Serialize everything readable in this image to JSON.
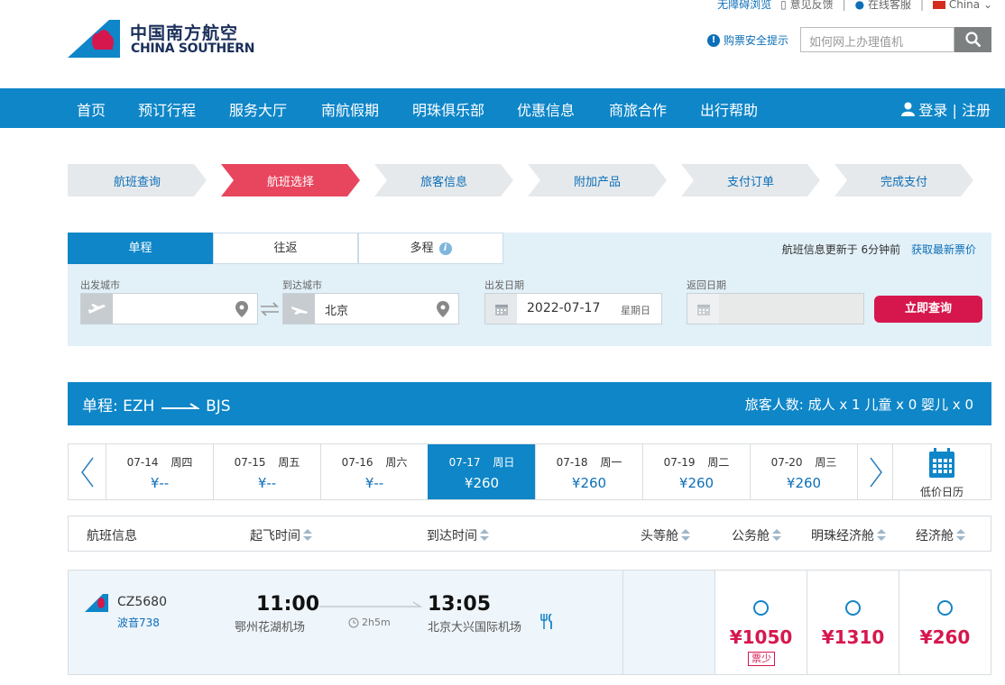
{
  "toplinks": {
    "accessible": "无障碍浏览",
    "feedback": "意见反馈",
    "service": "在线客服",
    "region": "China"
  },
  "brand": {
    "cn": "中国南方航空",
    "en": "CHINA SOUTHERN"
  },
  "header": {
    "safety_tip": "购票安全提示",
    "search_placeholder": "如何网上办理值机"
  },
  "nav": {
    "items": [
      "首页",
      "预订行程",
      "服务大厅",
      "南航假期",
      "明珠俱乐部",
      "优惠信息",
      "商旅合作",
      "出行帮助"
    ],
    "login": "登录 | 注册"
  },
  "steps": [
    "航班查询",
    "航班选择",
    "旅客信息",
    "附加产品",
    "支付订单",
    "完成支付"
  ],
  "search": {
    "tabs": [
      "单程",
      "往返",
      "多程"
    ],
    "update_text": "航班信息更新于 6分钟前",
    "refresh_link": "获取最新票价",
    "from_label": "出发城市",
    "from_value": "",
    "to_label": "到达城市",
    "to_value": "北京",
    "depart_label": "出发日期",
    "depart_value": "2022-07-17",
    "depart_dow": "星期日",
    "return_label": "返回日期",
    "query_button": "立即查询"
  },
  "route": {
    "summary_prefix": "单程: EZH",
    "summary_suffix": "BJS",
    "passengers": "旅客人数: 成人 x 1 儿童 x 0 婴儿 x 0"
  },
  "dates": [
    {
      "date": "07-14 周四",
      "price": "¥--"
    },
    {
      "date": "07-15 周五",
      "price": "¥--"
    },
    {
      "date": "07-16 周六",
      "price": "¥--"
    },
    {
      "date": "07-17 周日",
      "price": "¥260"
    },
    {
      "date": "07-18 周一",
      "price": "¥260"
    },
    {
      "date": "07-19 周二",
      "price": "¥260"
    },
    {
      "date": "07-20 周三",
      "price": "¥260"
    }
  ],
  "calendar_label": "低价日历",
  "table_headers": {
    "info": "航班信息",
    "depart": "起飞时间",
    "arrive": "到达时间",
    "first": "头等舱",
    "business": "公务舱",
    "premium": "明珠经济舱",
    "economy": "经济舱"
  },
  "flight": {
    "number": "CZ5680",
    "aircraft": "波音738",
    "dep_time": "11:00",
    "dep_airport": "鄂州花湖机场",
    "duration": "2h5m",
    "arr_time": "13:05",
    "arr_airport": "北京大兴国际机场",
    "business_price": "¥1050",
    "business_tag": "票少",
    "premium_price": "¥1310",
    "economy_price": "¥260"
  }
}
